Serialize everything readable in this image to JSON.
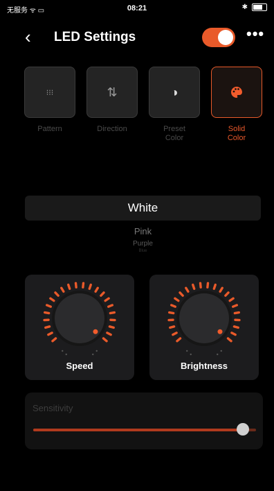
{
  "status_bar": {
    "carrier": "无服务 ᯤ ▭",
    "time": "08:21",
    "bluetooth": "✱"
  },
  "header": {
    "title": "LED Settings",
    "back_glyph": "‹",
    "more_glyph": "•••",
    "power_on": true
  },
  "modes": [
    {
      "label": "Pattern",
      "icon": "grid-dots-icon",
      "glyph": "⁝⁝⁝",
      "active": false
    },
    {
      "label": "Direction",
      "icon": "up-down-arrows-icon",
      "glyph": "⇅",
      "active": false
    },
    {
      "label": "Preset\nColor",
      "icon": "contrast-icon",
      "glyph": "◑",
      "active": false
    },
    {
      "label": "Solid\nColor",
      "icon": "palette-icon",
      "glyph": "●",
      "active": true
    }
  ],
  "color_picker": {
    "selected": "White",
    "options": [
      "Pink",
      "Purple",
      "Blue"
    ]
  },
  "dials": {
    "speed": {
      "label": "Speed"
    },
    "brightness": {
      "label": "Brightness"
    }
  },
  "sensitivity": {
    "label": "Sensitivity",
    "value_fraction": 0.94
  },
  "colors": {
    "accent": "#e95a2a",
    "background": "#000000",
    "card": "#1c1c1e",
    "muted_text": "#4b4b4b"
  }
}
